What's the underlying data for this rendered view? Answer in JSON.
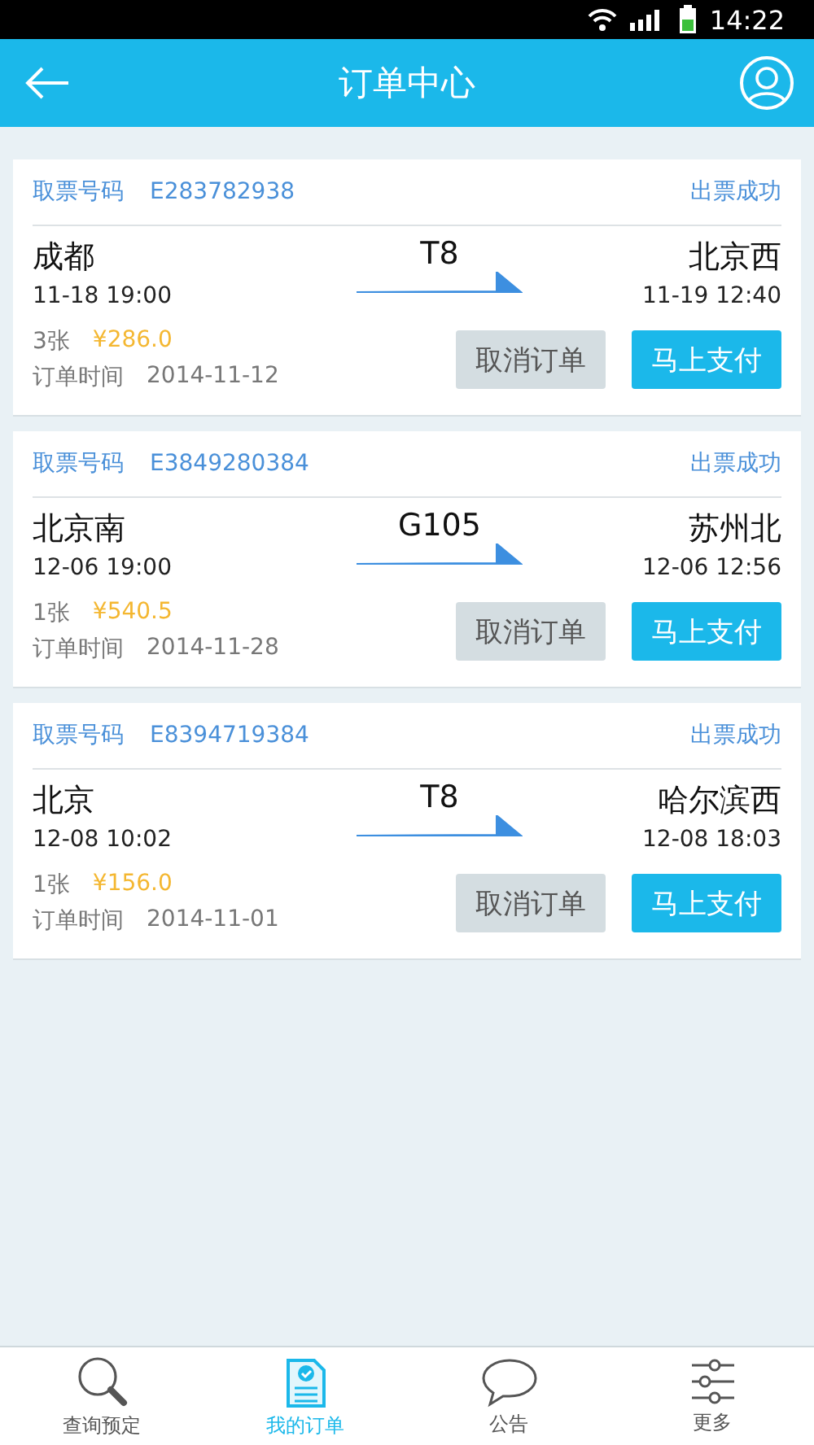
{
  "status_bar": {
    "time": "14:22"
  },
  "header": {
    "title": "订单中心"
  },
  "orders": [
    {
      "code_label": "取票号码",
      "code": "E283782938",
      "status": "出票成功",
      "from": "成都",
      "from_time": "11-18  19:00",
      "train": "T8",
      "to": "北京西",
      "to_time": "11-19  12:40",
      "count": "3张",
      "price": "¥286.0",
      "time_label": "订单时间",
      "order_date": "2014-11-12",
      "cancel": "取消订单",
      "pay": "马上支付"
    },
    {
      "code_label": "取票号码",
      "code": "E3849280384",
      "status": "出票成功",
      "from": "北京南",
      "from_time": "12-06  19:00",
      "train": "G105",
      "to": "苏州北",
      "to_time": "12-06  12:56",
      "count": "1张",
      "price": "¥540.5",
      "time_label": "订单时间",
      "order_date": "2014-11-28",
      "cancel": "取消订单",
      "pay": "马上支付"
    },
    {
      "code_label": "取票号码",
      "code": "E8394719384",
      "status": "出票成功",
      "from": "北京",
      "from_time": "12-08  10:02",
      "train": "T8",
      "to": "哈尔滨西",
      "to_time": "12-08  18:03",
      "count": "1张",
      "price": "¥156.0",
      "time_label": "订单时间",
      "order_date": "2014-11-01",
      "cancel": "取消订单",
      "pay": "马上支付"
    }
  ],
  "tabs": [
    {
      "kind": "search",
      "label": "查询预定",
      "selected": false
    },
    {
      "kind": "orders",
      "label": "我的订单",
      "selected": true
    },
    {
      "kind": "notice",
      "label": "公告",
      "selected": false
    },
    {
      "kind": "more",
      "label": "更多",
      "selected": false
    }
  ]
}
